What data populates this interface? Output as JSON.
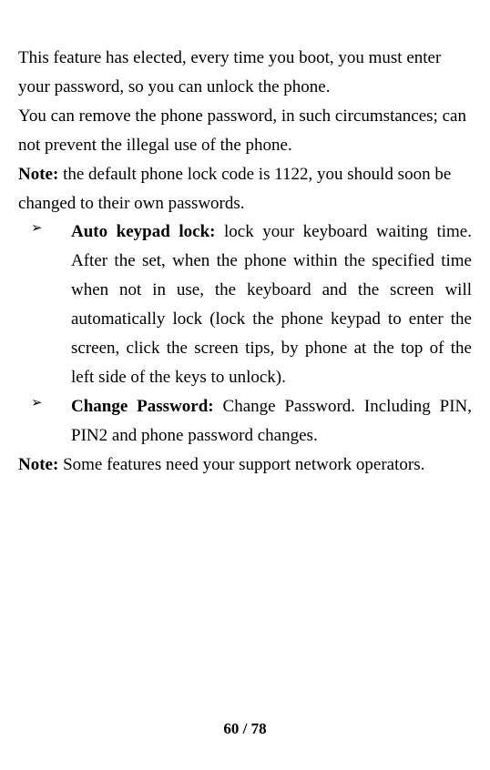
{
  "para1": "This feature has elected, every time you boot, you must enter your password, so you can unlock the phone.",
  "para2": "You can remove the phone password, in such circumstances; can not prevent the illegal use of the phone.",
  "note1_label": "Note:",
  "note1_text": " the default phone lock code is 1122, you should soon be changed to their own passwords.",
  "bullet1_label": "Auto keypad lock:",
  "bullet1_text": " lock your keyboard waiting time. After the set, when the phone within the specified time when not in use, the keyboard and the screen will automatically lock (lock the phone keypad to enter the screen, click the screen tips, by phone at the top of the left side of the keys to unlock).",
  "bullet2_label": "Change Password:",
  "bullet2_text": " Change Password. Including PIN, PIN2 and phone password changes.",
  "note2_label": "Note:",
  "note2_text": " Some features need your support network operators.",
  "bullet_marker": "➢",
  "page_number": "60 / 78"
}
